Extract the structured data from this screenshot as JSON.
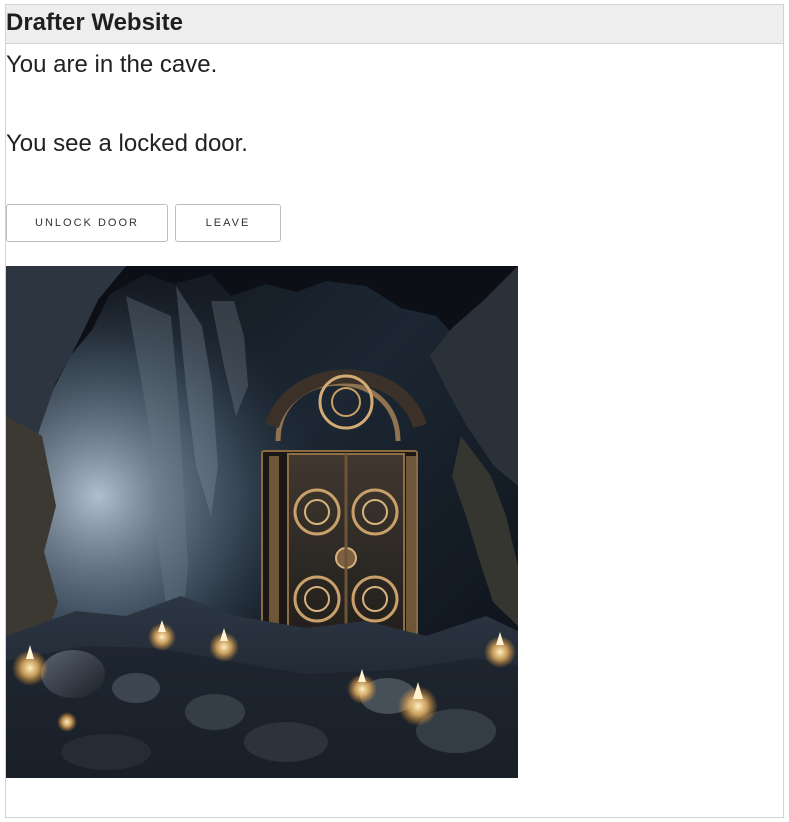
{
  "header": {
    "title": "Drafter Website"
  },
  "main": {
    "location_text": "You are in the cave.",
    "observation_text": "You see a locked door.",
    "buttons": {
      "unlock_label": "Unlock Door",
      "leave_label": "Leave"
    }
  },
  "image": {
    "icon": "cave-door-illustration"
  },
  "colors": {
    "header_bg": "#eeeeee",
    "border": "#d2d2d2",
    "text": "#222222",
    "button_border": "#bdbdbd"
  }
}
